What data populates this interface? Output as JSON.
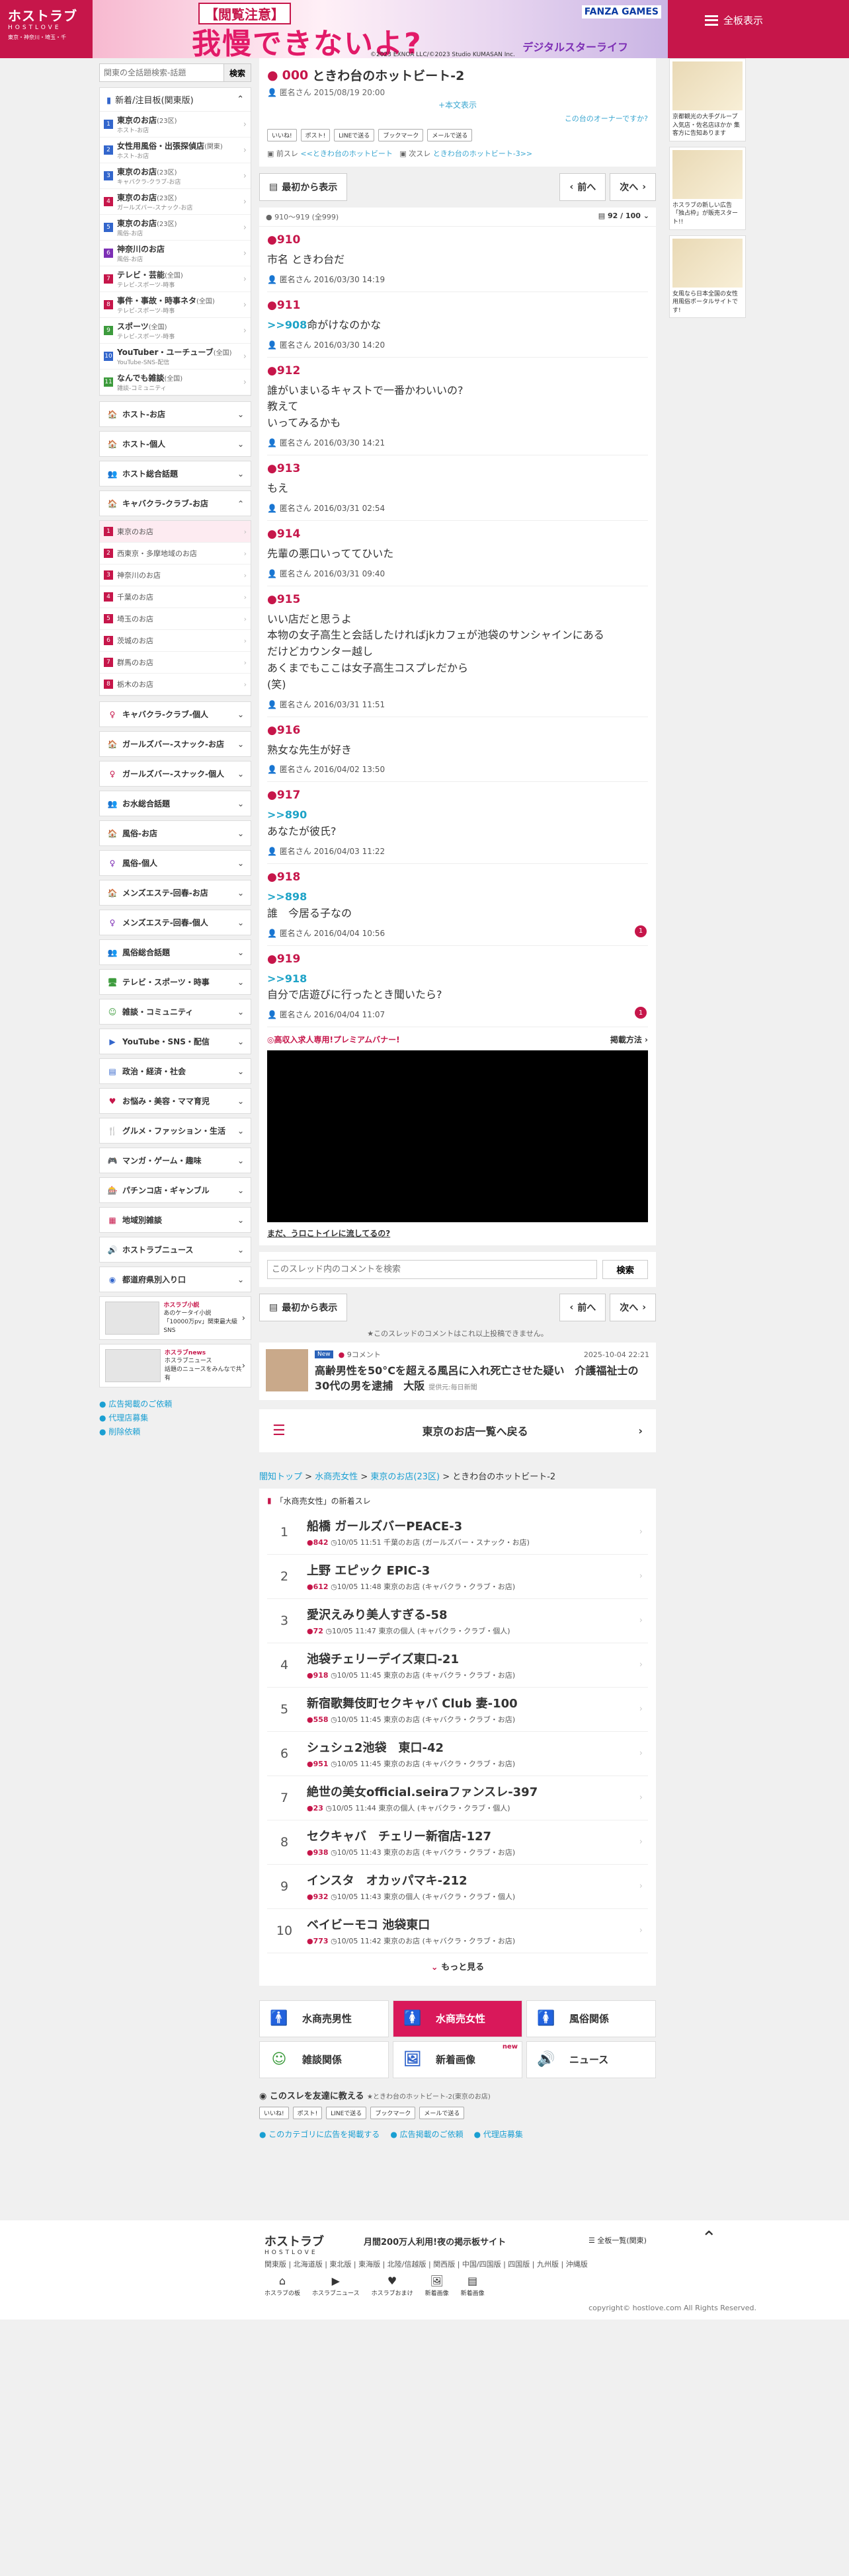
{
  "header": {
    "logo": "ホストラブ",
    "logo_sub": "HOSTLOVE",
    "logo_area": "東京・神奈川・埼玉・千",
    "all_label": "全板表示",
    "banner": {
      "tag": "【閲覧注意】",
      "main": "我慢できないよ?",
      "brand": "デジタルスターライフ",
      "fanza": "FANZA GAMES",
      "copy": "©2023 EXNOA LLC/©2023 Studio KUMASAN Inc."
    }
  },
  "left": {
    "search_placeholder": "関東の全話題検索-話題",
    "search_btn": "検索",
    "top_header": "新着/注目板(関東版)",
    "top_items": [
      {
        "n": "1",
        "t": "東京のお店",
        "c": "(23区)",
        "s": "ホスト-お店",
        "color": "#3366cc"
      },
      {
        "n": "2",
        "t": "女性用風俗・出張探偵店",
        "c": "(関東)",
        "s": "ホスト-お店",
        "color": "#3366cc"
      },
      {
        "n": "3",
        "t": "東京のお店",
        "c": "(23区)",
        "s": "キャバクラ-クラブ-お店",
        "color": "#3366cc"
      },
      {
        "n": "4",
        "t": "東京のお店",
        "c": "(23区)",
        "s": "ガールズバー-スナック-お店",
        "color": "#c6164a"
      },
      {
        "n": "5",
        "t": "東京のお店",
        "c": "(23区)",
        "s": "風俗-お店",
        "color": "#3366cc"
      },
      {
        "n": "6",
        "t": "神奈川のお店",
        "c": "",
        "s": "風俗-お店",
        "color": "#7d2fb5"
      },
      {
        "n": "7",
        "t": "テレビ・芸能",
        "c": "(全国)",
        "s": "テレビ-スポーツ-時事",
        "color": "#c6164a"
      },
      {
        "n": "8",
        "t": "事件・事故・時事ネタ",
        "c": "(全国)",
        "s": "テレビ-スポーツ-時事",
        "color": "#c6164a"
      },
      {
        "n": "9",
        "t": "スポーツ",
        "c": "(全国)",
        "s": "テレビ-スポーツ-時事",
        "color": "#3c9b3c"
      },
      {
        "n": "10",
        "t": "YouTuber・ユーチューブ",
        "c": "(全国)",
        "s": "YouTube-SNS-配信",
        "color": "#3366cc"
      },
      {
        "n": "11",
        "t": "なんでも雑談",
        "c": "(全国)",
        "s": "雑談-コミュニティ",
        "color": "#3c9b3c"
      }
    ],
    "sections_a": [
      {
        "t": "ホスト-お店",
        "icon": "🏠",
        "color": "#3366cc",
        "state": "⌄"
      },
      {
        "t": "ホスト-個人",
        "icon": "🏠",
        "color": "#3366cc",
        "state": "⌄"
      },
      {
        "t": "ホスト総合話題",
        "icon": "👥",
        "color": "#3366cc",
        "state": "⌄"
      },
      {
        "t": "キャバクラ-クラブ-お店",
        "icon": "🏠",
        "color": "#c6164a",
        "state": "⌃"
      }
    ],
    "kyaba_sub": [
      {
        "n": "1",
        "t": "東京のお店",
        "active": true
      },
      {
        "n": "2",
        "t": "西東京・多摩地域のお店"
      },
      {
        "n": "3",
        "t": "神奈川のお店"
      },
      {
        "n": "4",
        "t": "千葉のお店"
      },
      {
        "n": "5",
        "t": "埼玉のお店"
      },
      {
        "n": "6",
        "t": "茨城のお店"
      },
      {
        "n": "7",
        "t": "群馬のお店"
      },
      {
        "n": "8",
        "t": "栃木のお店"
      }
    ],
    "sections_b": [
      {
        "t": "キャバクラ-クラブ-個人",
        "icon": "♀",
        "color": "#c6164a"
      },
      {
        "t": "ガールズバー-スナック-お店",
        "icon": "🏠",
        "color": "#c6164a"
      },
      {
        "t": "ガールズバー-スナック-個人",
        "icon": "♀",
        "color": "#c6164a"
      },
      {
        "t": "お水総合話題",
        "icon": "👥",
        "color": "#c6164a"
      },
      {
        "t": "風俗-お店",
        "icon": "🏠",
        "color": "#7d2fb5"
      },
      {
        "t": "風俗-個人",
        "icon": "♀",
        "color": "#7d2fb5"
      },
      {
        "t": "メンズエステ-回春-お店",
        "icon": "🏠",
        "color": "#7d2fb5"
      },
      {
        "t": "メンズエステ-回春-個人",
        "icon": "♀",
        "color": "#7d2fb5"
      },
      {
        "t": "風俗総合話題",
        "icon": "👥",
        "color": "#7d2fb5"
      },
      {
        "t": "テレビ・スポーツ・時事",
        "icon": "🖥",
        "color": "#3c9b3c"
      },
      {
        "t": "雑談・コミュニティ",
        "icon": "☺",
        "color": "#3c9b3c"
      },
      {
        "t": "YouTube・SNS・配信",
        "icon": "▶",
        "color": "#3366cc"
      },
      {
        "t": "政治・経済・社会",
        "icon": "▤",
        "color": "#3366cc"
      },
      {
        "t": "お悩み・美容・ママ育児",
        "icon": "♥",
        "color": "#c6164a"
      },
      {
        "t": "グルメ・ファッション・生活",
        "icon": "🍴",
        "color": "#c6164a"
      },
      {
        "t": "マンガ・ゲーム・趣味",
        "icon": "🎮",
        "color": "#7d2fb5"
      },
      {
        "t": "パチンコ店・ギャンブル",
        "icon": "🎰",
        "color": "#c6164a"
      },
      {
        "t": "地域別雑談",
        "icon": "▦",
        "color": "#c6164a"
      },
      {
        "t": "ホストラブニュース",
        "icon": "🔊",
        "color": "#333"
      },
      {
        "t": "都道府県別入り口",
        "icon": "◉",
        "color": "#3366cc"
      }
    ],
    "ads": [
      {
        "l1": "ホスラブ小説",
        "l2": "あのケータイ小説",
        "l3": "「10000万pv」関東最大級SNS"
      },
      {
        "l1": "ホスラブnews",
        "l2": "ホスラブニュース",
        "l3": "話題のニュースをみんなで共有"
      }
    ],
    "links": [
      "広告掲載のご依頼",
      "代理店募集",
      "削除依頼"
    ]
  },
  "thread": {
    "num": "000",
    "title": "ときわ台のホットビート-2",
    "author": "匿名さん",
    "date": "2015/08/19 20:00",
    "orig_label": "+本文表示",
    "owner_label": "この台のオーナーですか?",
    "share": [
      "いいね!",
      "ポスト!",
      "LINEで送る",
      "ブックマーク",
      "メールで送る"
    ],
    "prev_label": "前スレ",
    "prev_link": "<<ときわ台のホットビート",
    "next_label": "次スレ",
    "next_link": "ときわ台のホットビート-3>>",
    "btn_first": "最初から表示",
    "btn_prev": "前へ",
    "btn_next": "次へ",
    "range": "910〜919 (全999)",
    "pages": "92 / 100"
  },
  "posts": [
    {
      "n": "910",
      "ref": "",
      "body": "市名 ときわ台だ",
      "who": "匿名さん",
      "date": "2016/03/30 14:19"
    },
    {
      "n": "911",
      "ref": ">>908",
      "body": "命がけなのかな",
      "who": "匿名さん",
      "date": "2016/03/30 14:20"
    },
    {
      "n": "912",
      "ref": "",
      "body": "誰がいまいるキャストで一番かわいいの?\n教えて\nいってみるかも",
      "who": "匿名さん",
      "date": "2016/03/30 14:21"
    },
    {
      "n": "913",
      "ref": "",
      "body": "もえ",
      "who": "匿名さん",
      "date": "2016/03/31 02:54"
    },
    {
      "n": "914",
      "ref": "",
      "body": "先輩の悪口いっててひいた",
      "who": "匿名さん",
      "date": "2016/03/31 09:40"
    },
    {
      "n": "915",
      "ref": "",
      "body": "いい店だと思うよ\n本物の女子高生と会話したければjkカフェが池袋のサンシャインにある\nだけどカウンター越し\nあくまでもここは女子高生コスプレだから\n(笑)",
      "who": "匿名さん",
      "date": "2016/03/31 11:51"
    },
    {
      "n": "916",
      "ref": "",
      "body": "熟女な先生が好き",
      "who": "匿名さん",
      "date": "2016/04/02 13:50"
    },
    {
      "n": "917",
      "ref": ">>890",
      "body": "\nあなたが彼氏?",
      "who": "匿名さん",
      "date": "2016/04/03 11:22"
    },
    {
      "n": "918",
      "ref": ">>898",
      "body": "\n誰　今居る子なの",
      "who": "匿名さん",
      "date": "2016/04/04 10:56",
      "badge": "1"
    },
    {
      "n": "919",
      "ref": ">>918",
      "body": "\n自分で店遊びに行ったとき聞いたら?",
      "who": "匿名さん",
      "date": "2016/04/04 11:07",
      "badge": "1"
    }
  ],
  "premium": {
    "title": "◎高収入求人専用!プレミアムバナー!",
    "link": "掲載方法 ›",
    "foot": "まだ、うロこトイレに流してるの?"
  },
  "tsearch": {
    "placeholder": "このスレッド内のコメントを検索",
    "btn": "検索"
  },
  "note": "★このスレッドのコメントはこれ以上投稿できません。",
  "news": {
    "new": "New",
    "count": "9コメント",
    "date": "2025-10-04 22:21",
    "title": "高齢男性を50°Cを超える風呂に入れ死亡させた疑い　介護福祉士の30代の男を逮捕　大阪",
    "src": "提供元:毎日新聞"
  },
  "back_label": "東京のお店一覧へ戻る",
  "crumbs": [
    "闇知トップ",
    "水商売女性",
    "東京のお店(23区)"
  ],
  "crumb_last": "ときわ台のホットビート-2",
  "newthreads": {
    "head": "「水商売女性」の新着スレ",
    "rows": [
      {
        "r": "1",
        "t": "船橋 ガールズバーPEACE-3",
        "c": "842",
        "d": "10/05 11:51",
        "b": "千葉のお店",
        "cat": "(ガールズバー・スナック・お店)"
      },
      {
        "r": "2",
        "t": "上野 エピック EPIC-3",
        "c": "612",
        "d": "10/05 11:48",
        "b": "東京のお店",
        "cat": "(キャバクラ・クラブ・お店)"
      },
      {
        "r": "3",
        "t": "愛沢えみり美人すぎる-58",
        "c": "72",
        "d": "10/05 11:47",
        "b": "東京の個人",
        "cat": "(キャバクラ・クラブ・個人)"
      },
      {
        "r": "4",
        "t": "池袋チェリーデイズ東口-21",
        "c": "918",
        "d": "10/05 11:45",
        "b": "東京のお店",
        "cat": "(キャバクラ・クラブ・お店)"
      },
      {
        "r": "5",
        "t": "新宿歌舞伎町セクキャバ Club 妻-100",
        "c": "558",
        "d": "10/05 11:45",
        "b": "東京のお店",
        "cat": "(キャバクラ・クラブ・お店)"
      },
      {
        "r": "6",
        "t": "シュシュ2池袋　東口-42",
        "c": "951",
        "d": "10/05 11:45",
        "b": "東京のお店",
        "cat": "(キャバクラ・クラブ・お店)"
      },
      {
        "r": "7",
        "t": "絶世の美女official.seiraファンスレ-397",
        "c": "23",
        "d": "10/05 11:44",
        "b": "東京の個人",
        "cat": "(キャバクラ・クラブ・個人)"
      },
      {
        "r": "8",
        "t": "セクキャバ　チェリー新宿店-127",
        "c": "938",
        "d": "10/05 11:43",
        "b": "東京のお店",
        "cat": "(キャバクラ・クラブ・お店)"
      },
      {
        "r": "9",
        "t": "インスタ　オカッパマキ-212",
        "c": "932",
        "d": "10/05 11:43",
        "b": "東京の個人",
        "cat": "(キャバクラ・クラブ・個人)"
      },
      {
        "r": "10",
        "t": "ベイビーモコ 池袋東口",
        "c": "773",
        "d": "10/05 11:42",
        "b": "東京のお店",
        "cat": "(キャバクラ・クラブ・お店)"
      }
    ],
    "more": "もっと見る"
  },
  "cats": [
    {
      "t": "水商売男性",
      "i": "🚹",
      "c": "#3366cc"
    },
    {
      "t": "水商売女性",
      "i": "🚺",
      "c": "#fff",
      "sel": true
    },
    {
      "t": "風俗関係",
      "i": "🚺",
      "c": "#7d2fb5"
    },
    {
      "t": "雑談関係",
      "i": "☺",
      "c": "#3c9b3c"
    },
    {
      "t": "新着画像",
      "i": "🖼",
      "c": "#3366cc",
      "nw": "new"
    },
    {
      "t": "ニュース",
      "i": "🔊",
      "c": "#333"
    }
  ],
  "sharebot": {
    "h": "このスレを友達に教える",
    "sub": "★ときわ台のホットビート-2(東京のお店)",
    "links": [
      "このカテゴリに広告を掲載する",
      "広告掲載のご依頼",
      "代理店募集"
    ]
  },
  "right": [
    {
      "t": "京都観光の大手グループ入気店・佐名店ほかか 集客方に告知あります"
    },
    {
      "t": "ホスラブの新しい広告「独占枠」が販売スタート!!"
    },
    {
      "t": "女風なら日本全国の女性用風俗ポータルサイトです!"
    }
  ],
  "footer": {
    "logo": "ホストラブ",
    "sub": "HOSTLOVE",
    "tag": "月間200万人利用!夜の掲示板サイト",
    "all": "全板一覧(関東)",
    "areas": "関東版 | 北海道版 | 東北版 | 東海版 | 北陸/信越版 | 関西版 | 中国/四国版 | 四国版 | 九州版 | 沖縄版",
    "nav": [
      {
        "i": "⌂",
        "t": "ホスラブの板"
      },
      {
        "i": "▶",
        "t": "ホスラブニュース"
      },
      {
        "i": "♥",
        "t": "ホスラブおまけ"
      },
      {
        "i": "🖼",
        "t": "新着画像"
      },
      {
        "i": "▤",
        "t": "新着画像"
      }
    ],
    "copy": "copyright© hostlove.com All Rights Reserved."
  }
}
